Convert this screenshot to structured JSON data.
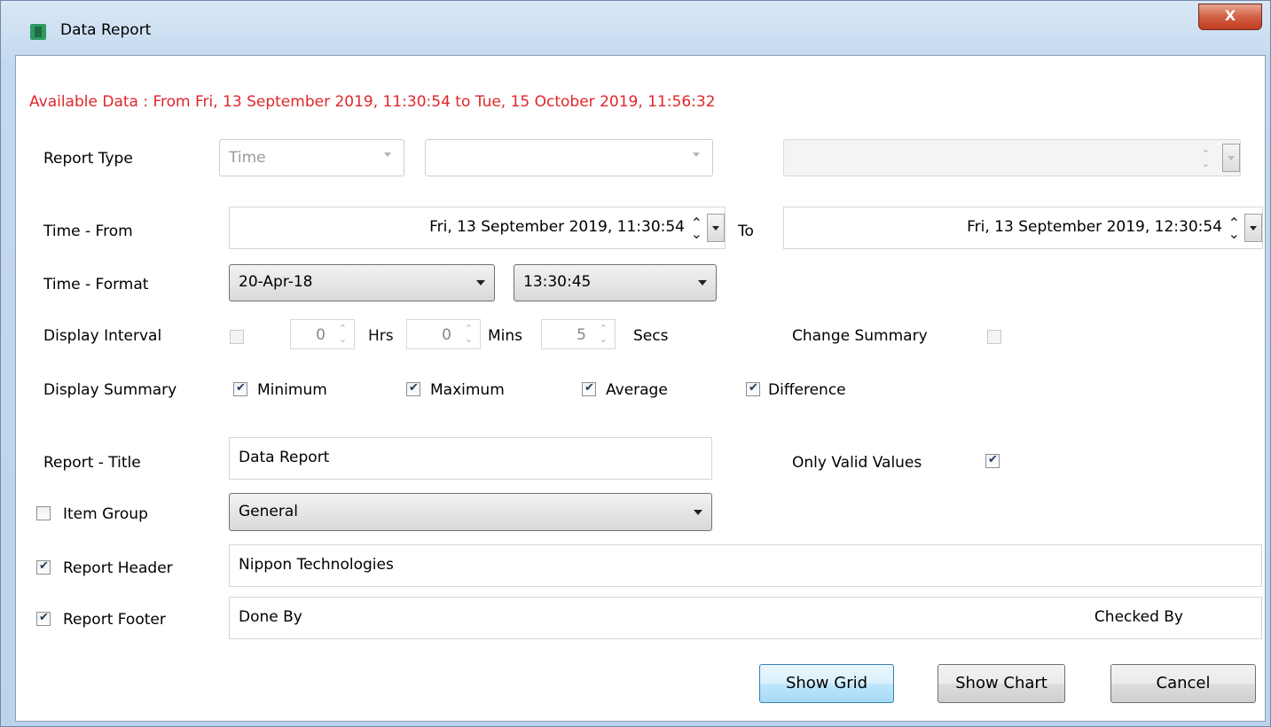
{
  "window": {
    "title": "Data Report",
    "close_glyph": "X"
  },
  "available_data": "Available Data : From Fri, 13 September 2019, 11:30:54 to Tue, 15 October 2019, 11:56:32",
  "report_type": {
    "label": "Report Type",
    "type_value": "Time",
    "second_value": "",
    "third_value": ""
  },
  "time_from": {
    "label": "Time  -  From",
    "value": "Fri, 13 September 2019, 11:30:54",
    "to_label": "To",
    "to_value": "Fri, 13 September 2019, 12:30:54"
  },
  "time_format": {
    "label": "Time  -  Format",
    "date_format": "20-Apr-18",
    "time_format": "13:30:45"
  },
  "display_interval": {
    "label": "Display Interval",
    "enabled": false,
    "hrs": "0",
    "hrs_label": "Hrs",
    "mins": "0",
    "mins_label": "Mins",
    "secs": "5",
    "secs_label": "Secs",
    "change_summary_label": "Change Summary",
    "change_summary": false
  },
  "display_summary": {
    "label": "Display Summary",
    "options": [
      {
        "label": "Minimum",
        "checked": true
      },
      {
        "label": "Maximum",
        "checked": true
      },
      {
        "label": "Average",
        "checked": true
      },
      {
        "label": "Difference",
        "checked": true
      }
    ]
  },
  "report_title": {
    "label": "Report - Title",
    "value": "Data Report",
    "only_valid_label": "Only Valid Values",
    "only_valid": true
  },
  "item_group": {
    "label": "Item Group",
    "checked": false,
    "value": "General"
  },
  "report_header": {
    "label": "Report Header",
    "checked": true,
    "value": "Nippon Technologies"
  },
  "report_footer": {
    "label": "Report Footer",
    "checked": true,
    "left_value": "Done By",
    "right_value": "Checked By"
  },
  "buttons": {
    "show_grid": "Show Grid",
    "show_chart": "Show Chart",
    "cancel": "Cancel"
  },
  "colors": {
    "available_data_text": "#e0262a",
    "focus_button": "#bee6fd"
  }
}
